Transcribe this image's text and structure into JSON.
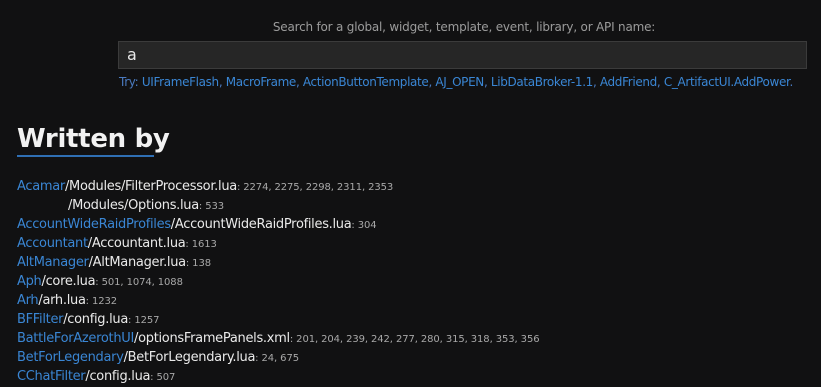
{
  "search": {
    "prompt": "Search for a global, widget, template, event, library, or API name:",
    "value": "a",
    "try_label": "Try:",
    "suggestions": [
      "UIFrameFlash",
      "MacroFrame",
      "ActionButtonTemplate",
      "AJ_OPEN",
      "LibDataBroker-1.1",
      "AddFriend",
      "C_ArtifactUI.AddPower"
    ],
    "try_end": "."
  },
  "section": {
    "title": "Written by"
  },
  "results": [
    {
      "addon": "Acamar",
      "path": "/Modules/FilterProcessor.lua",
      "lines": ": 2274, 2275, 2298, 2311, 2353"
    },
    {
      "addon": "",
      "path": "/Modules/Options.lua",
      "lines": ": 533"
    },
    {
      "addon": "AccountWideRaidProfiles",
      "path": "/AccountWideRaidProfiles.lua",
      "lines": ": 304"
    },
    {
      "addon": "Accountant",
      "path": "/Accountant.lua",
      "lines": ": 1613"
    },
    {
      "addon": "AltManager",
      "path": "/AltManager.lua",
      "lines": ": 138"
    },
    {
      "addon": "Aph",
      "path": "/core.lua",
      "lines": ": 501, 1074, 1088"
    },
    {
      "addon": "Arh",
      "path": "/arh.lua",
      "lines": ": 1232"
    },
    {
      "addon": "BFFilter",
      "path": "/config.lua",
      "lines": ": 1257"
    },
    {
      "addon": "BattleForAzerothUI",
      "path": "/optionsFramePanels.xml",
      "lines": ": 201, 204, 239, 242, 277, 280, 315, 318, 353, 356"
    },
    {
      "addon": "BetForLegendary",
      "path": "/BetForLegendary.lua",
      "lines": ": 24, 675"
    },
    {
      "addon": "CChatFilter",
      "path": "/config.lua",
      "lines": ": 507"
    }
  ]
}
